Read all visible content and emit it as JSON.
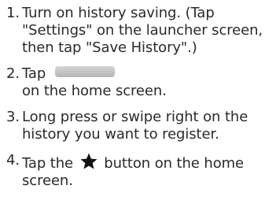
{
  "steps": [
    {
      "number": "1.",
      "text": "Turn on history saving. (Tap \"Settings\" on the launcher screen, then tap \"Save History\".)"
    },
    {
      "number": "2.",
      "prefix": "Tap",
      "suffix": "on the home screen.",
      "button_icon": "history-button"
    },
    {
      "number": "3.",
      "text": "Long press or swipe right on the history you want to register."
    },
    {
      "number": "4.",
      "prefix": "Tap the",
      "suffix": "button on the home screen.",
      "icon": "star-icon"
    }
  ],
  "colors": {
    "text": "#2a2a2a",
    "button": "#c4c4c4",
    "star": "#111111"
  }
}
